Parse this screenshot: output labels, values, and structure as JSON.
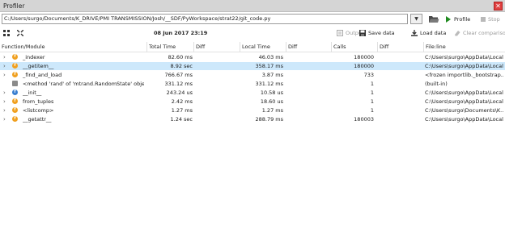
{
  "window": {
    "title": "Profiler",
    "close_label": "✕"
  },
  "pathbar": {
    "path": "C:/Users/surgo/Documents/K_DRIVE/PMI TRANSMISSION/Josh/__SDF/PyWorkspace/strat22/git_code.py",
    "dropdown_icon": "chevron-down-icon",
    "open_icon": "folder-open-icon",
    "profile_label": "Profile",
    "stop_label": "Stop"
  },
  "toolbar": {
    "datetime": "08 Jun 2017 23:19",
    "output_label": "Output",
    "save_label": "Save data",
    "load_label": "Load data",
    "clear_label": "Clear comparison"
  },
  "table": {
    "headers": {
      "function": "Function/Module",
      "total_time": "Total Time",
      "diff1": "Diff",
      "local_time": "Local Time",
      "diff2": "Diff",
      "calls": "Calls",
      "diff3": "Diff",
      "file": "File:line"
    },
    "rows": [
      {
        "name": "_indexer",
        "total": "82.60 ms",
        "local": "46.03 ms",
        "calls": "180000",
        "file": "C:\\Users\\surgo\\AppData\\Local",
        "icon": "orange",
        "expander": "›",
        "selected": false
      },
      {
        "name": "__getitem__",
        "total": "8.92 sec",
        "local": "358.17 ms",
        "calls": "180000",
        "file": "C:\\Users\\surgo\\AppData\\Local",
        "icon": "orange",
        "expander": "›",
        "selected": true
      },
      {
        "name": "_find_and_load",
        "total": "766.67 ms",
        "local": "3.87 ms",
        "calls": "733",
        "file": "<frozen importlib._bootstrap...",
        "icon": "orange",
        "expander": "›",
        "selected": false
      },
      {
        "name": "<method 'rand' of 'mtrand.RandomState' objects>",
        "total": "331.12 ms",
        "local": "331.12 ms",
        "calls": "1",
        "file": "(built-in)",
        "icon": "gray",
        "expander": "",
        "selected": false
      },
      {
        "name": "__init__",
        "total": "243.24 us",
        "local": "10.58 us",
        "calls": "1",
        "file": "C:\\Users\\surgo\\AppData\\Local",
        "icon": "blue",
        "expander": "›",
        "selected": false
      },
      {
        "name": "from_tuples",
        "total": "2.42 ms",
        "local": "18.60 us",
        "calls": "1",
        "file": "C:\\Users\\surgo\\AppData\\Local",
        "icon": "orange",
        "expander": "›",
        "selected": false
      },
      {
        "name": "<listcomp>",
        "total": "1.27 ms",
        "local": "1.27 ms",
        "calls": "1",
        "file": "C:\\Users\\surgo\\Documents\\K...",
        "icon": "orange",
        "expander": "›",
        "selected": false
      },
      {
        "name": "__getattr__",
        "total": "1.24 sec",
        "local": "288.79 ms",
        "calls": "180003",
        "file": "C:\\Users\\surgo\\AppData\\Local",
        "icon": "orange",
        "expander": "›",
        "selected": false
      }
    ]
  },
  "colors": {
    "selected_row": "#cde8fb",
    "function_icon": "#f0a020",
    "class_icon": "#3a7fd0",
    "builtin_icon": "#8a8a8a",
    "play_icon": "#1f8a1f",
    "close": "#e04040"
  }
}
